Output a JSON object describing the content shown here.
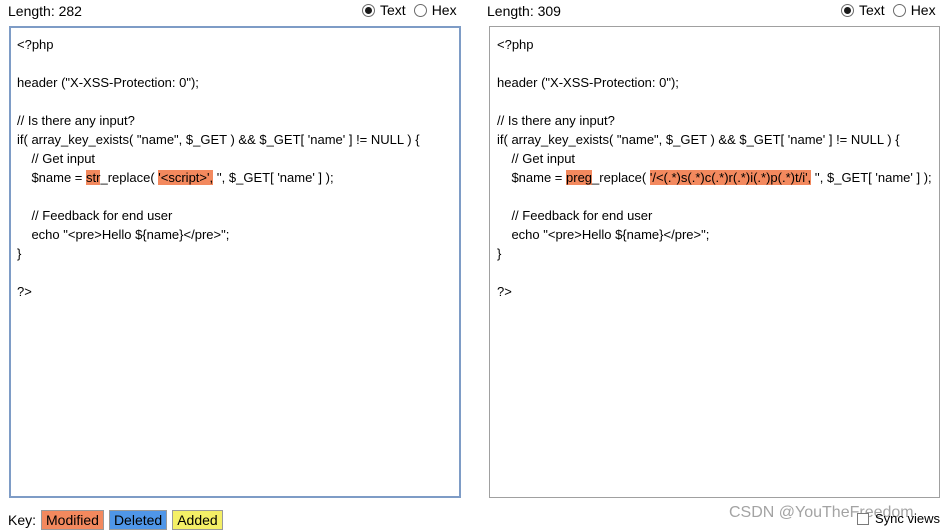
{
  "left": {
    "length_label": "Length: 282",
    "radio_text": "Text",
    "radio_hex": "Hex",
    "code": {
      "l1": "<?php",
      "l2": "",
      "l3": "header (\"X-XSS-Protection: 0\");",
      "l4": "",
      "l5": "// Is there any input?",
      "l6": "if( array_key_exists( \"name\", $_GET ) && $_GET[ 'name' ] != NULL ) {",
      "l7": "    // Get input",
      "l8_a": "    $name = ",
      "l8_hl1": "str",
      "l8_b": "_replace( ",
      "l8_hl2": "'<script>',",
      "l8_c": " '', $_GET[ 'name' ] );",
      "l9": "",
      "l10": "    // Feedback for end user",
      "l11": "    echo \"<pre>Hello ${name}</pre>\";",
      "l12": "}",
      "l13": "",
      "l14": "?>"
    }
  },
  "right": {
    "length_label": "Length: 309",
    "radio_text": "Text",
    "radio_hex": "Hex",
    "code": {
      "l1": "<?php",
      "l2": "",
      "l3": "header (\"X-XSS-Protection: 0\");",
      "l4": "",
      "l5": "// Is there any input?",
      "l6": "if( array_key_exists( \"name\", $_GET ) && $_GET[ 'name' ] != NULL ) {",
      "l7": "    // Get input",
      "l8_a": "    $name = ",
      "l8_hl1": "preg",
      "l8_b": "_replace( ",
      "l8_hl2": "'/<(.*)s(.*)c(.*)r(.*)i(.*)p(.*)t/i',",
      "l8_c": " '', $_GET[ 'name' ] );",
      "l9": "",
      "l10": "    // Feedback for end user",
      "l11": "    echo \"<pre>Hello ${name}</pre>\";",
      "l12": "}",
      "l13": "",
      "l14": "?>"
    }
  },
  "legend": {
    "key_label": "Key:",
    "modified": "Modified",
    "deleted": "Deleted",
    "added": "Added",
    "colors": {
      "modified": "#f3895e",
      "deleted": "#4f96e8",
      "added": "#f4ef66"
    }
  },
  "sync_views_label": "Sync views",
  "watermark": "CSDN @YouTheFreedom"
}
